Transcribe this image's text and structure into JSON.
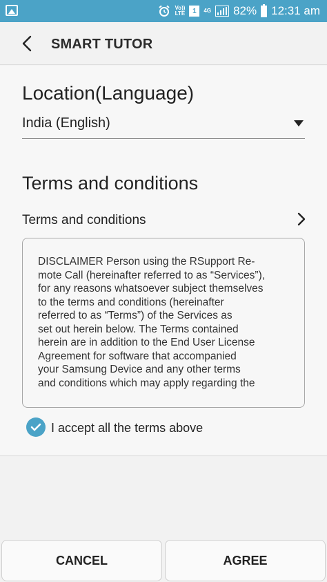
{
  "status_bar": {
    "volte_top": "Vo))",
    "volte_bottom": "LTE",
    "sim": "1",
    "network": "4G",
    "battery": "82%",
    "time": "12:31 am"
  },
  "app_bar": {
    "title": "SMART TUTOR"
  },
  "location": {
    "heading": "Location(Language)",
    "selected": "India (English)"
  },
  "terms": {
    "heading": "Terms and conditions",
    "link_label": "Terms and conditions",
    "text": "DISCLAIMER Person using the RSupport Re-\nmote Call (hereinafter referred to as “Services”),\nfor any reasons whatsoever subject themselves\nto the terms and conditions (hereinafter\nreferred to as “Terms”) of the Services as\nset out herein below. The Terms contained\nherein are in addition to the End User License\nAgreement for software that accompanied\nyour Samsung Device and any other terms\nand conditions which may apply regarding the",
    "accept_label": "I accept all the terms above",
    "accepted": true
  },
  "buttons": {
    "cancel": "CANCEL",
    "agree": "AGREE"
  },
  "colors": {
    "accent": "#4ba3c7"
  }
}
